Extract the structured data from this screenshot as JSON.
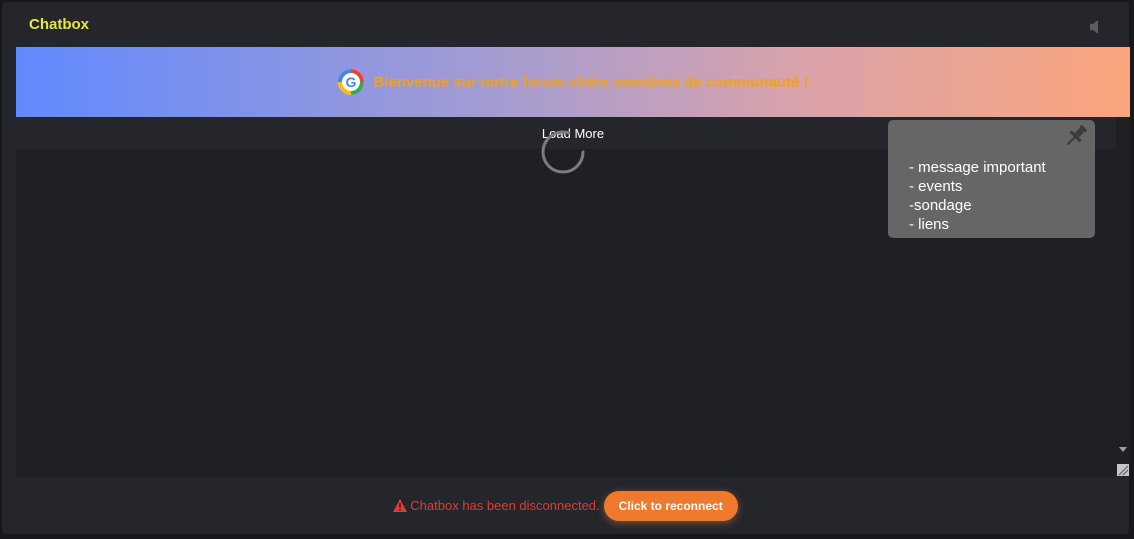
{
  "chatbox": {
    "title": "Chatbox",
    "sound_icon": "speaker-icon"
  },
  "banner": {
    "logo_icon": "google-logo-icon",
    "text": "Bienvenue sur notre forum chérs membres de communauté !"
  },
  "messages": {
    "load_more_label": "Load More",
    "spinner_icon": "loading-spinner-icon"
  },
  "pinned": {
    "pin_icon": "pushpin-icon",
    "lines": [
      "- message important",
      "- events",
      "-sondage",
      "- liens"
    ]
  },
  "footer": {
    "warning_icon": "warning-triangle-icon",
    "status_text": "Chatbox has been disconnected.",
    "reconnect_label": "Click to reconnect"
  },
  "colors": {
    "title": "#e8e83a",
    "banner_text": "#f2a11c",
    "error": "#e53935",
    "accent": "#ef7a2e"
  }
}
